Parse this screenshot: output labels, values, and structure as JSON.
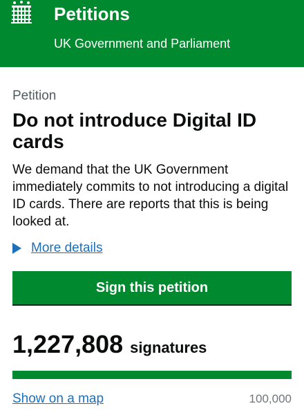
{
  "header": {
    "logo_icon": "portcullis-icon",
    "title": "Petitions",
    "subtitle": "UK Government and Parliament",
    "background_color": "#00892e"
  },
  "petition": {
    "caption": "Petition",
    "title": "Do not introduce Digital ID cards",
    "description": "We demand that the UK Government immediately commits to not introducing a digital ID cards. There are reports that this is being looked at.",
    "details_icon": "triangle-right-icon",
    "details_label": "More details",
    "sign_button_label": "Sign this petition"
  },
  "signatures": {
    "count": "1,227,808",
    "label": "signatures",
    "progress_fraction": 1.0,
    "map_link_label": "Show on a map",
    "threshold": "100,000"
  },
  "colors": {
    "accent_green": "#00892e",
    "link_blue": "#1d70b8"
  }
}
